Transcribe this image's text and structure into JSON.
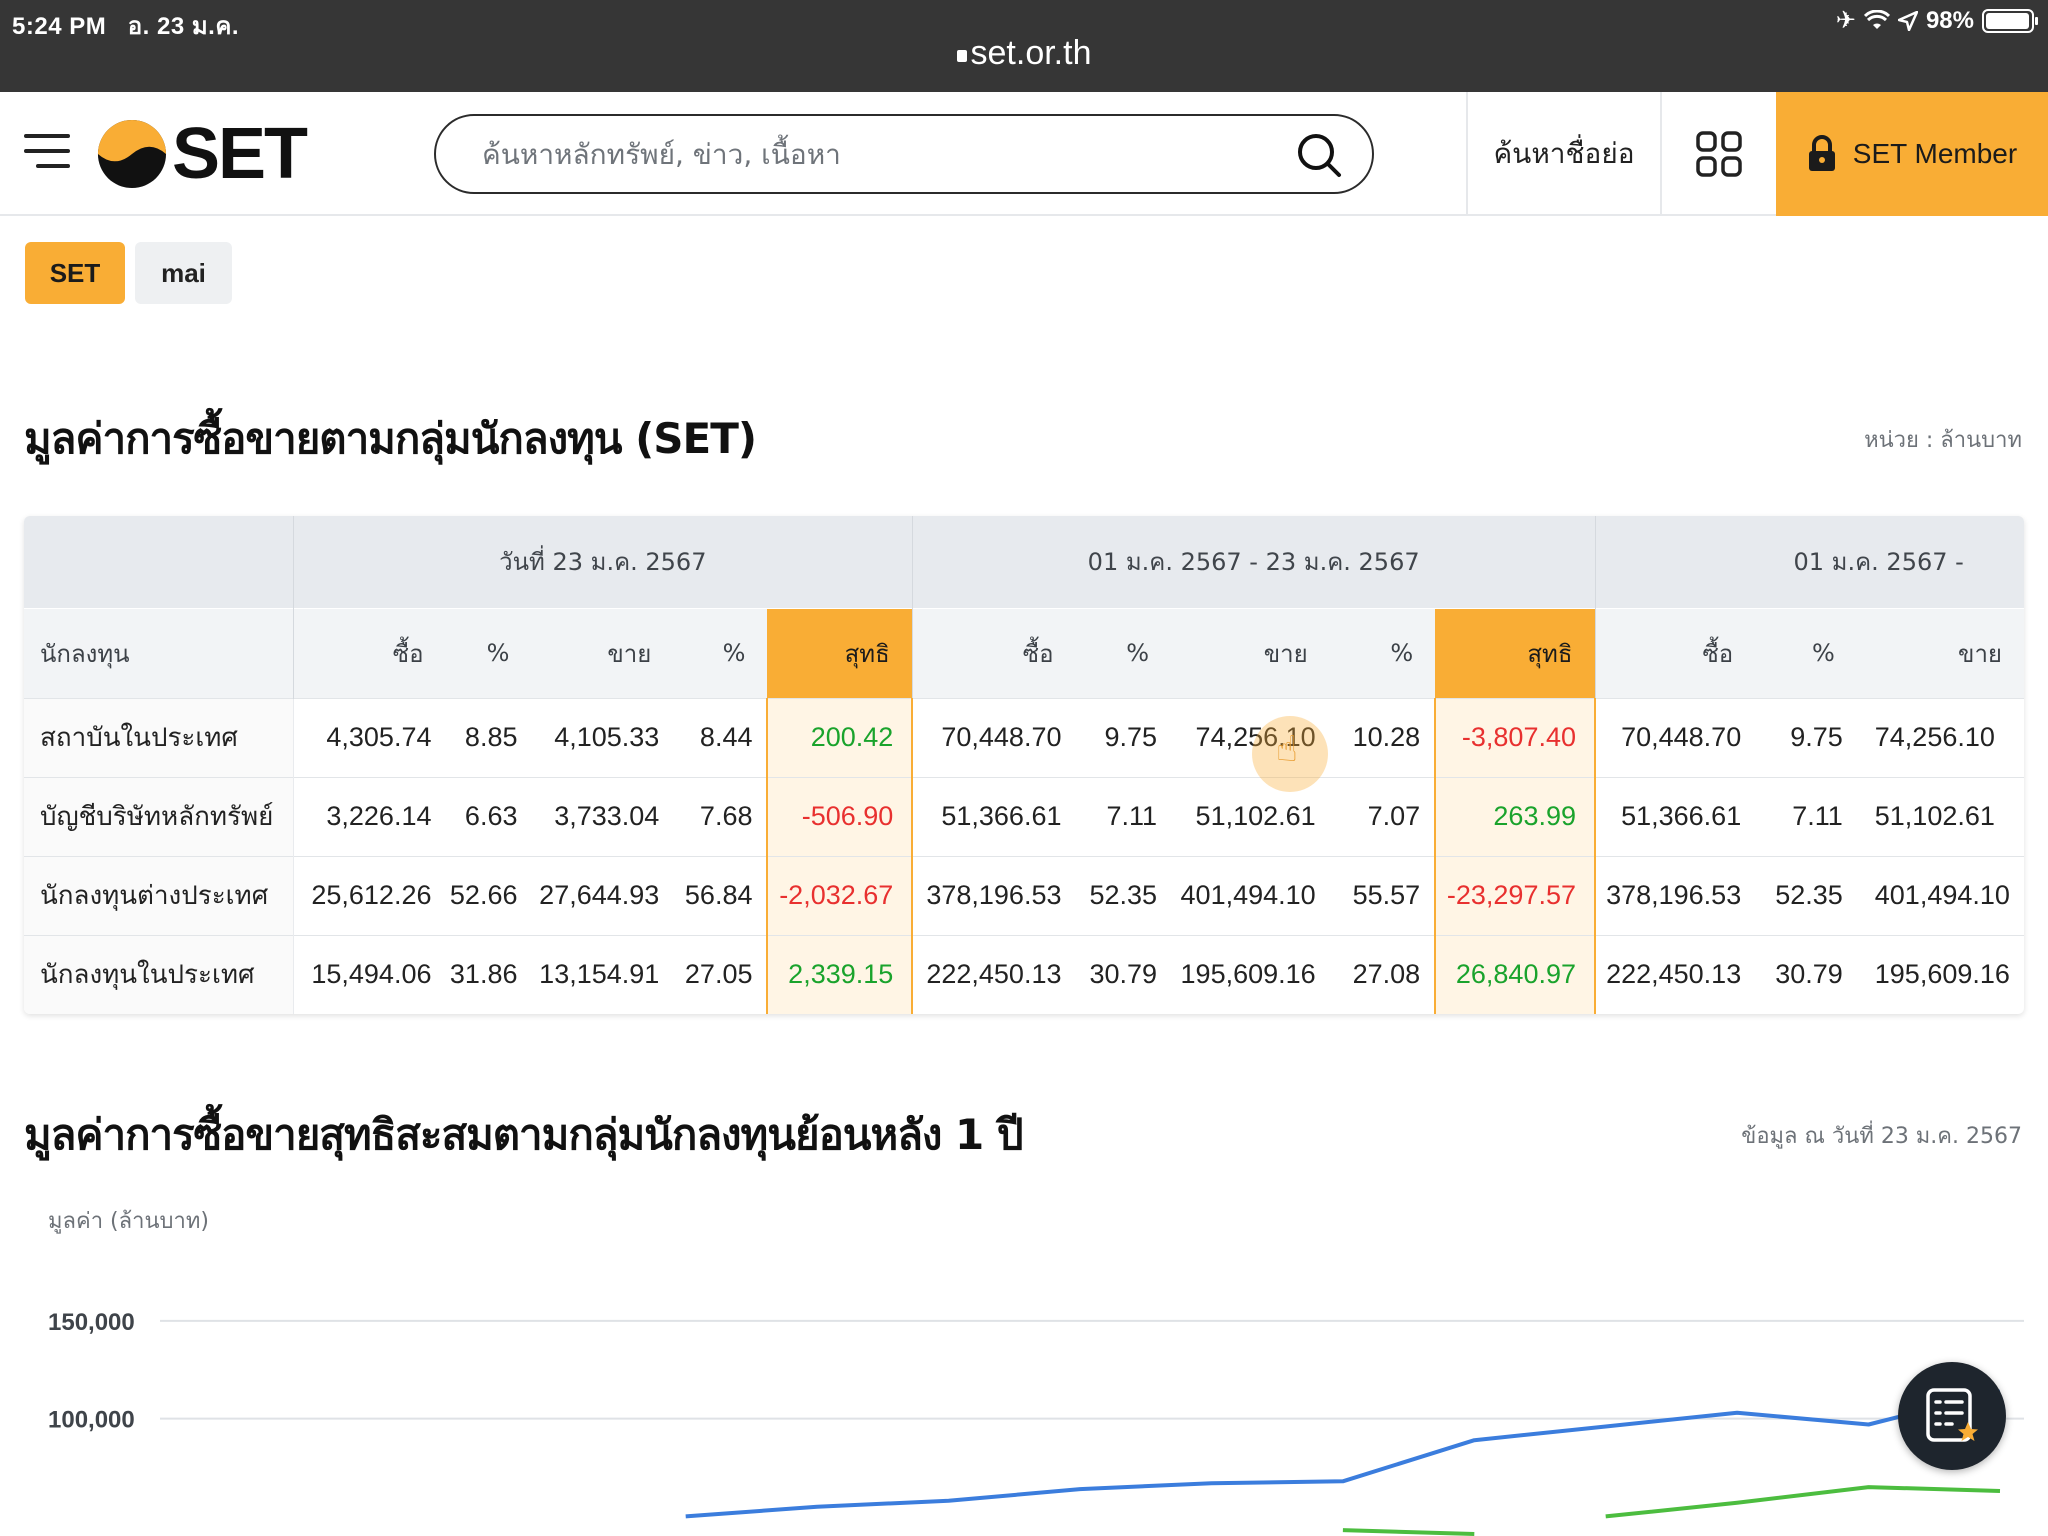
{
  "status_bar": {
    "time": "5:24 PM",
    "date": "อ. 23 ม.ค.",
    "battery": "98%"
  },
  "url_bar": {
    "domain": "set.or.th"
  },
  "header": {
    "logo_text": "SET",
    "search_placeholder": "ค้นหาหลักทรัพย์, ข่าว, เนื้อหา",
    "symbol_search_label": "ค้นหาชื่อย่อ",
    "member_label": "SET Member"
  },
  "market_tabs": [
    "SET",
    "mai"
  ],
  "trading_section": {
    "title": "มูลค่าการซื้อขายตามกลุ่มนักลงทุน (SET)",
    "unit_note": "หน่วย : ล้านบาท",
    "period_headers": [
      "วันที่ 23 ม.ค. 2567",
      "01 ม.ค. 2567 - 23 ม.ค. 2567",
      "01 ม.ค. 2567 -"
    ],
    "column_headers": [
      "นักลงทุน",
      "ซื้อ",
      "%",
      "ขาย",
      "%",
      "สุทธิ",
      "ซื้อ",
      "%",
      "ขาย",
      "%",
      "สุทธิ",
      "ซื้อ",
      "%",
      "ขาย"
    ],
    "rows": [
      {
        "investor": "สถาบันในประเทศ",
        "d_buy": "4,305.74",
        "d_buy_pct": "8.85",
        "d_sell": "4,105.33",
        "d_sell_pct": "8.44",
        "d_net": "200.42",
        "d_net_sign": "pos",
        "m_buy": "70,448.70",
        "m_buy_pct": "9.75",
        "m_sell": "74,256.10",
        "m_sell_pct": "10.28",
        "m_net": "-3,807.40",
        "m_net_sign": "neg",
        "y_buy": "70,448.70",
        "y_buy_pct": "9.75",
        "y_sell": "74,256.10"
      },
      {
        "investor": "บัญชีบริษัทหลักทรัพย์",
        "d_buy": "3,226.14",
        "d_buy_pct": "6.63",
        "d_sell": "3,733.04",
        "d_sell_pct": "7.68",
        "d_net": "-506.90",
        "d_net_sign": "neg",
        "m_buy": "51,366.61",
        "m_buy_pct": "7.11",
        "m_sell": "51,102.61",
        "m_sell_pct": "7.07",
        "m_net": "263.99",
        "m_net_sign": "pos",
        "y_buy": "51,366.61",
        "y_buy_pct": "7.11",
        "y_sell": "51,102.61"
      },
      {
        "investor": "นักลงทุนต่างประเทศ",
        "d_buy": "25,612.26",
        "d_buy_pct": "52.66",
        "d_sell": "27,644.93",
        "d_sell_pct": "56.84",
        "d_net": "-2,032.67",
        "d_net_sign": "neg",
        "m_buy": "378,196.53",
        "m_buy_pct": "52.35",
        "m_sell": "401,494.10",
        "m_sell_pct": "55.57",
        "m_net": "-23,297.57",
        "m_net_sign": "neg",
        "y_buy": "378,196.53",
        "y_buy_pct": "52.35",
        "y_sell": "401,494.10"
      },
      {
        "investor": "นักลงทุนในประเทศ",
        "d_buy": "15,494.06",
        "d_buy_pct": "31.86",
        "d_sell": "13,154.91",
        "d_sell_pct": "27.05",
        "d_net": "2,339.15",
        "d_net_sign": "pos",
        "m_buy": "222,450.13",
        "m_buy_pct": "30.79",
        "m_sell": "195,609.16",
        "m_sell_pct": "27.08",
        "m_net": "26,840.97",
        "m_net_sign": "pos",
        "y_buy": "222,450.13",
        "y_buy_pct": "30.79",
        "y_sell": "195,609.16"
      }
    ]
  },
  "cumulative_section": {
    "title": "มูลค่าการซื้อขายสุทธิสะสมตามกลุ่มนักลงทุนย้อนหลัง 1 ปี",
    "data_date_note": "ข้อมูล ณ วันที่ 23 ม.ค. 2567"
  },
  "chart_data": {
    "type": "line",
    "ylabel": "มูลค่า (ล้านบาท)",
    "y_ticks": [
      "150,000",
      "100,000"
    ],
    "y_tick_values": [
      150000,
      100000
    ],
    "ylim": [
      40000,
      152000
    ],
    "grid": true,
    "series": [
      {
        "color": "#3b7ddd",
        "values": [
          null,
          null,
          null,
          null,
          50000,
          55000,
          58000,
          64000,
          67000,
          68000,
          89000,
          96000,
          103000,
          97000,
          114000
        ]
      },
      {
        "color": "#4cbd3f",
        "values": [
          null,
          null,
          null,
          null,
          null,
          null,
          null,
          null,
          null,
          null,
          null,
          50000,
          57000,
          65000,
          63000
        ]
      }
    ],
    "series_extra": [
      {
        "values": [
          null,
          null,
          null,
          null,
          null,
          null,
          null,
          null,
          null,
          43000,
          41000,
          null,
          null,
          null,
          null
        ]
      }
    ]
  },
  "colors": {
    "accent": "#f9ad35",
    "positive": "#1aa32c",
    "negative": "#e8302f"
  },
  "icons": {
    "menu": "hamburger-icon",
    "search": "search-icon",
    "apps": "grid-icon",
    "lock": "lock-icon",
    "fab": "watchlist-icon"
  }
}
